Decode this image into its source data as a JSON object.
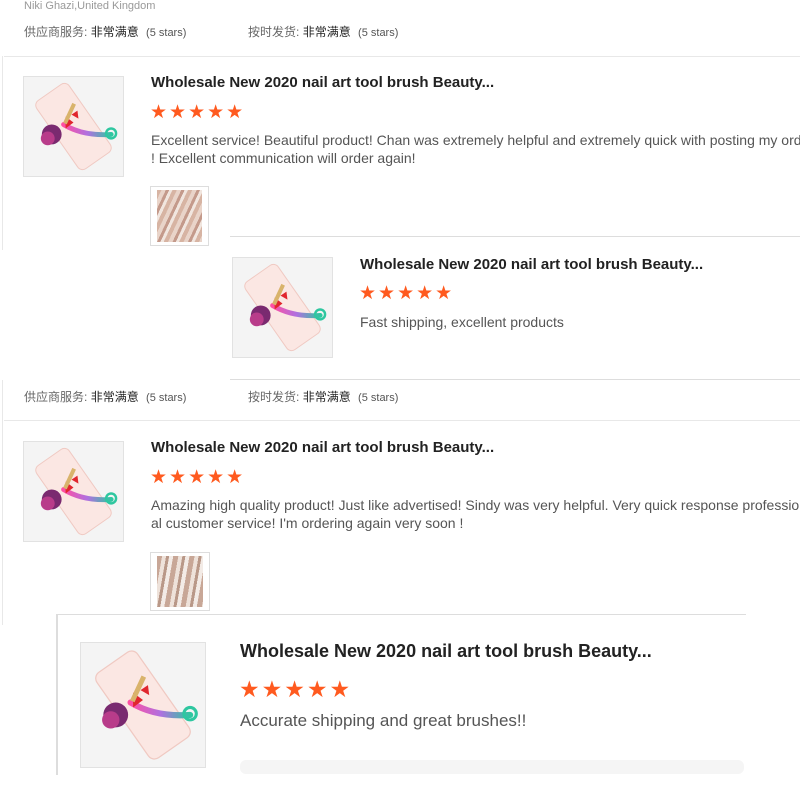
{
  "reviewer": {
    "name_location": "Niki Ghazi,United Kingdom"
  },
  "rating_labels": {
    "supplier_service": "供应商服务:",
    "on_time_delivery": "按时发货:",
    "value": "非常满意",
    "stars_text": "(5 stars)"
  },
  "reviews": [
    {
      "product_title": "Wholesale New 2020 nail art tool brush Beauty...",
      "stars": "★★★★★",
      "rating": 5,
      "comment_line1": "Excellent service! Beautiful product! Chan was extremely helpful and extremely quick with posting my order",
      "comment_line2": "! Excellent communication will order again!"
    },
    {
      "product_title": "Wholesale New 2020 nail art tool brush Beauty...",
      "stars": "★★★★★",
      "rating": 5,
      "comment_line1": "Fast shipping, excellent products"
    },
    {
      "product_title": "Wholesale New 2020 nail art tool brush Beauty...",
      "stars": "★★★★★",
      "rating": 5,
      "comment_line1": "Amazing high quality product! Just like advertised! Sindy was very helpful.  Very quick response profession",
      "comment_line2": "al customer service! I'm ordering again very soon !"
    },
    {
      "product_title": "Wholesale New 2020 nail art tool brush Beauty...",
      "stars": "★★★★★",
      "rating": 5,
      "comment_line1": "Accurate shipping and great brushes!!"
    }
  ],
  "colors": {
    "star": "#ff5a1f",
    "title": "#222222",
    "text": "#555555"
  }
}
